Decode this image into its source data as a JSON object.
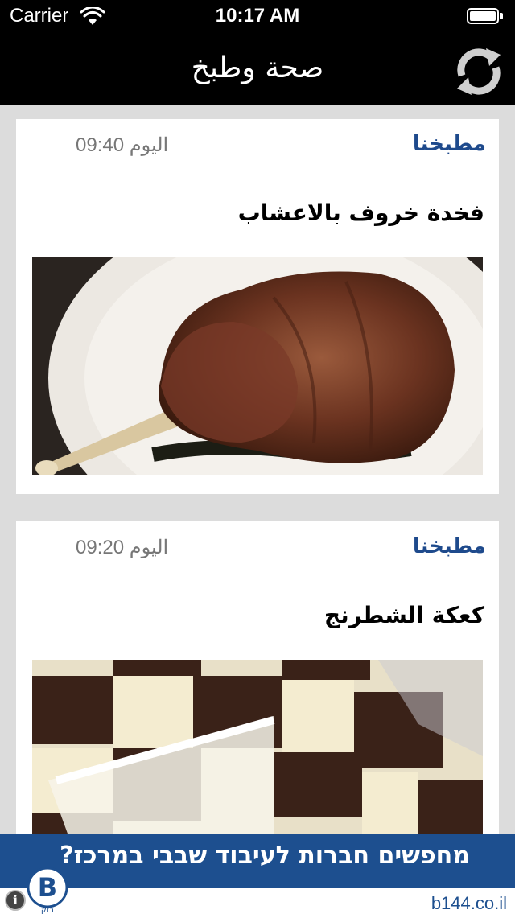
{
  "status_bar": {
    "carrier": "Carrier",
    "time": "10:17 AM"
  },
  "nav": {
    "title": "صحة وطبخ",
    "refresh_icon": "refresh-icon"
  },
  "articles": [
    {
      "category": "مطبخنا",
      "date": "اليوم 09:40",
      "title": "فخدة خروف بالاعشاب",
      "image": "roasted lamb leg"
    },
    {
      "category": "مطبخنا",
      "date": "اليوم 09:20",
      "title": "كعكة الشطرنج",
      "image": "checkerboard cake"
    }
  ],
  "ad": {
    "text": "מחפשים חברות לעיבוד שבבי במרכז?",
    "url": "b144.co.il",
    "logo_text": "B",
    "logo_sub": "בזק"
  },
  "colors": {
    "accent": "#1e4a8c",
    "ad_background": "#1d4f8f",
    "nav_background": "#000000"
  }
}
